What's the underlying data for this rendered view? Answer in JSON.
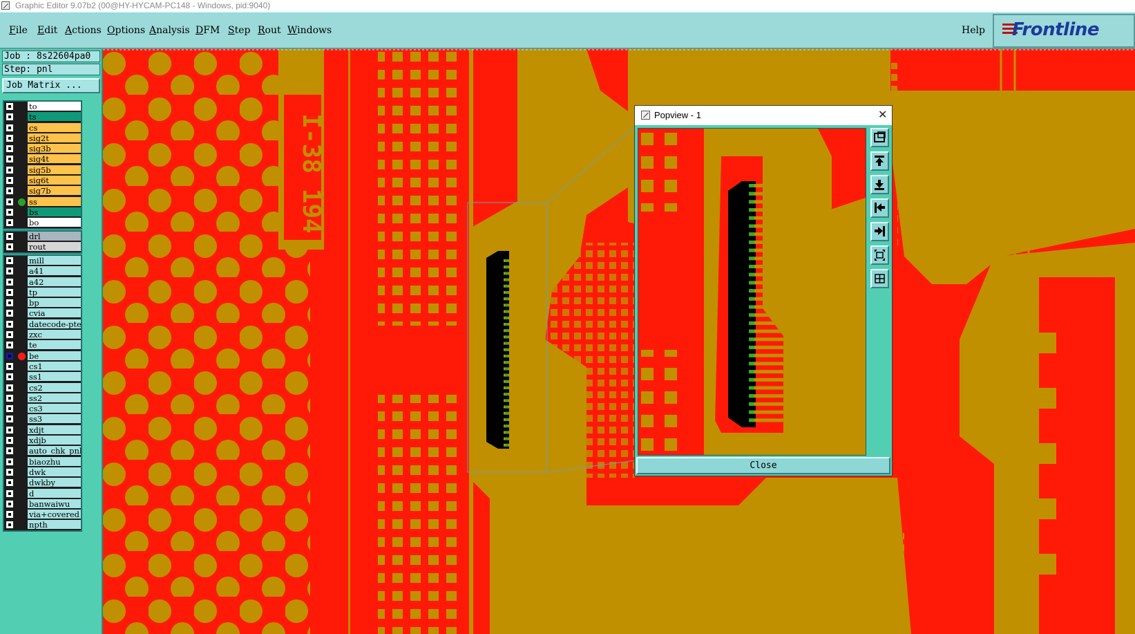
{
  "window": {
    "title": "Graphic Editor 9.07b2 (00@HY-HYCAM-PC148 - Windows, pid:9040)"
  },
  "menu": {
    "items": [
      {
        "label": "File",
        "ul": "F",
        "rest": "ile"
      },
      {
        "label": "Edit",
        "ul": "E",
        "rest": "dit"
      },
      {
        "label": "Actions",
        "ul": "A",
        "rest": "ctions"
      },
      {
        "label": "Options",
        "ul": "O",
        "rest": "ptions"
      },
      {
        "label": "Analysis",
        "ul": "A",
        "rest": "nalysis"
      },
      {
        "label": "DFM",
        "ul": "D",
        "rest": "FM"
      },
      {
        "label": "Step",
        "ul": "S",
        "rest": "tep"
      },
      {
        "label": "Rout",
        "ul": "R",
        "rest": "out"
      },
      {
        "label": "Windows",
        "ul": "W",
        "rest": "indows"
      }
    ],
    "help": "Help",
    "logo": "Frontline"
  },
  "job": {
    "job_label": "Job : 8s22604pa0",
    "step_label": "Step: pnl",
    "matrix_button": "Job Matrix ..."
  },
  "layers": {
    "board": [
      {
        "name": "to",
        "color": "#ffffff"
      },
      {
        "name": "ts",
        "color": "#0e9a78"
      },
      {
        "name": "cs",
        "color": "#ffc24a"
      },
      {
        "name": "sig2t",
        "color": "#ffc24a"
      },
      {
        "name": "sig3b",
        "color": "#ffc24a"
      },
      {
        "name": "sig4t",
        "color": "#ffc24a"
      },
      {
        "name": "sig5b",
        "color": "#ffc24a"
      },
      {
        "name": "sig6t",
        "color": "#ffc24a"
      },
      {
        "name": "sig7b",
        "color": "#ffc24a"
      },
      {
        "name": "ss",
        "color": "#ffc24a",
        "dot": "#2aa02a"
      },
      {
        "name": "bs",
        "color": "#0e9a78"
      },
      {
        "name": "bo",
        "color": "#ffffff"
      }
    ],
    "drill": [
      {
        "name": "drl",
        "color": "#a9b6bd"
      },
      {
        "name": "rout",
        "color": "#d6d6d6"
      }
    ],
    "misc": [
      {
        "name": "mill",
        "color": "#a8e4e4"
      },
      {
        "name": "a41",
        "color": "#a8e4e4"
      },
      {
        "name": "a42",
        "color": "#a8e4e4"
      },
      {
        "name": "tp",
        "color": "#a8e4e4"
      },
      {
        "name": "bp",
        "color": "#a8e4e4"
      },
      {
        "name": "cvia",
        "color": "#a8e4e4"
      },
      {
        "name": "datecode-pte",
        "color": "#a8e4e4"
      },
      {
        "name": "zxc",
        "color": "#a8e4e4"
      },
      {
        "name": "te",
        "color": "#a8e4e4"
      },
      {
        "name": "be",
        "color": "#a8e4e4",
        "dot": "#ff1a1a",
        "active": true
      },
      {
        "name": "cs1",
        "color": "#a8e4e4"
      },
      {
        "name": "ss1",
        "color": "#a8e4e4"
      },
      {
        "name": "cs2",
        "color": "#a8e4e4"
      },
      {
        "name": "ss2",
        "color": "#a8e4e4"
      },
      {
        "name": "cs3",
        "color": "#a8e4e4"
      },
      {
        "name": "ss3",
        "color": "#a8e4e4"
      },
      {
        "name": "xdjt",
        "color": "#a8e4e4"
      },
      {
        "name": "xdjb",
        "color": "#a8e4e4"
      },
      {
        "name": "auto_chk_pnl",
        "color": "#a8e4e4"
      },
      {
        "name": "biaozhu",
        "color": "#a8e4e4"
      },
      {
        "name": "dwk",
        "color": "#a8e4e4"
      },
      {
        "name": "dwkby",
        "color": "#a8e4e4"
      },
      {
        "name": "d",
        "color": "#a8e4e4"
      },
      {
        "name": "banwaiwu",
        "color": "#a8e4e4"
      },
      {
        "name": "via+covered",
        "color": "#a8e4e4"
      },
      {
        "name": "npth",
        "color": "#a8e4e4"
      }
    ]
  },
  "canvas": {
    "board_text": "I-38 194"
  },
  "popview": {
    "title": "Popview - 1",
    "close_button": "Close",
    "tools": [
      "fit-view-icon",
      "pan-up-icon",
      "pan-down-icon",
      "pan-left-icon",
      "pan-right-icon",
      "zoom-out-icon",
      "zoom-in-icon"
    ]
  },
  "colors": {
    "canvas_bg": "#ff1a08",
    "copper": "#c09000",
    "panel": "#52cfb2",
    "menubar": "#9cd9d9",
    "solder_mask": "#000000",
    "highlight": "#3aaa2a"
  }
}
